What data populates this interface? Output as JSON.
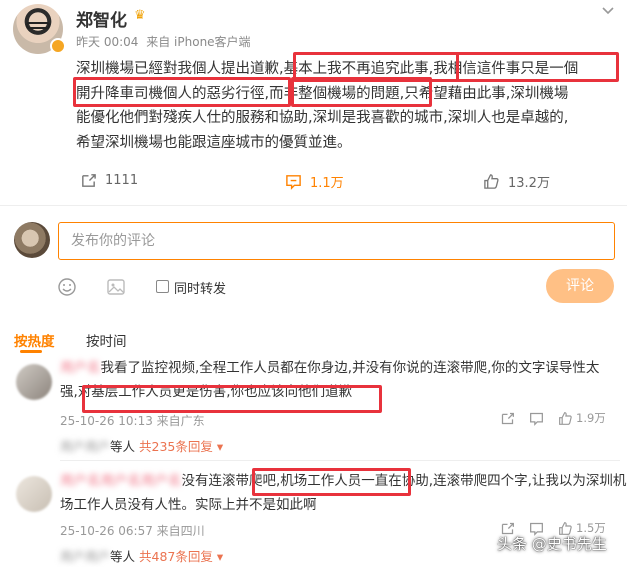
{
  "post": {
    "author": "郑智化",
    "time": "昨天 00:04",
    "source": "来自 iPhone客户端",
    "text_line1_a": "深圳機場已經對我個人提出道歉,",
    "text_line1_b": "基本上我不再追究此事,",
    "text_line1_c": "我相信這件事只是一個",
    "text_line2_a": "開升降車司機個人的惡劣行徑,",
    "text_line2_b": "而非整個機場的問題,",
    "text_line2_c": "只希望藉由此事,深圳機場",
    "text_line3": "能優化他們對殘疾人仕的服務和協助,深圳是我喜歡的城市,深圳人也是卓越的,",
    "text_line4": "希望深圳機場也能跟這座城市的優質並進。"
  },
  "actions": {
    "repost_count": "1111",
    "comment_count": "1.1万",
    "like_count": "13.2万"
  },
  "comment_box": {
    "placeholder": "发布你的评论",
    "repost_label": "同时转发",
    "submit_label": "评论"
  },
  "tabs": {
    "hot": "按热度",
    "time": "按时间"
  },
  "comments": [
    {
      "line1_a": "用户名",
      "line1_b": "我看了监控视频,全程工作人员都在你身边,并没有你说的连滚带爬,你的文字误导性太",
      "line2_a": "强,",
      "line2_b": "对基层工作人员更是伤害,你也应该向他们道歉",
      "time": "25-10-26 10:13 来自广东",
      "reply_prefix": "等人",
      "reply_count": "共235条回复",
      "likes": "1.9万"
    },
    {
      "line1_a": "用户名用户名用户名",
      "line1_b": "没有连滚带爬吧,",
      "line1_c": "机场工作人员一直在协助,",
      "line1_d": "连滚带爬四个字,让我以为深圳机",
      "line2": "场工作人员没有人性。实际上并不是如此啊",
      "time": "25-10-26 06:57 来自四川",
      "reply_prefix": "等人",
      "reply_count": "共487条回复",
      "likes": "1.5万"
    }
  ],
  "watermark": "头条 @史书先生",
  "colors": {
    "accent": "#ff8200",
    "highlight_box": "#e8323c",
    "reply_link": "#eb7350"
  }
}
